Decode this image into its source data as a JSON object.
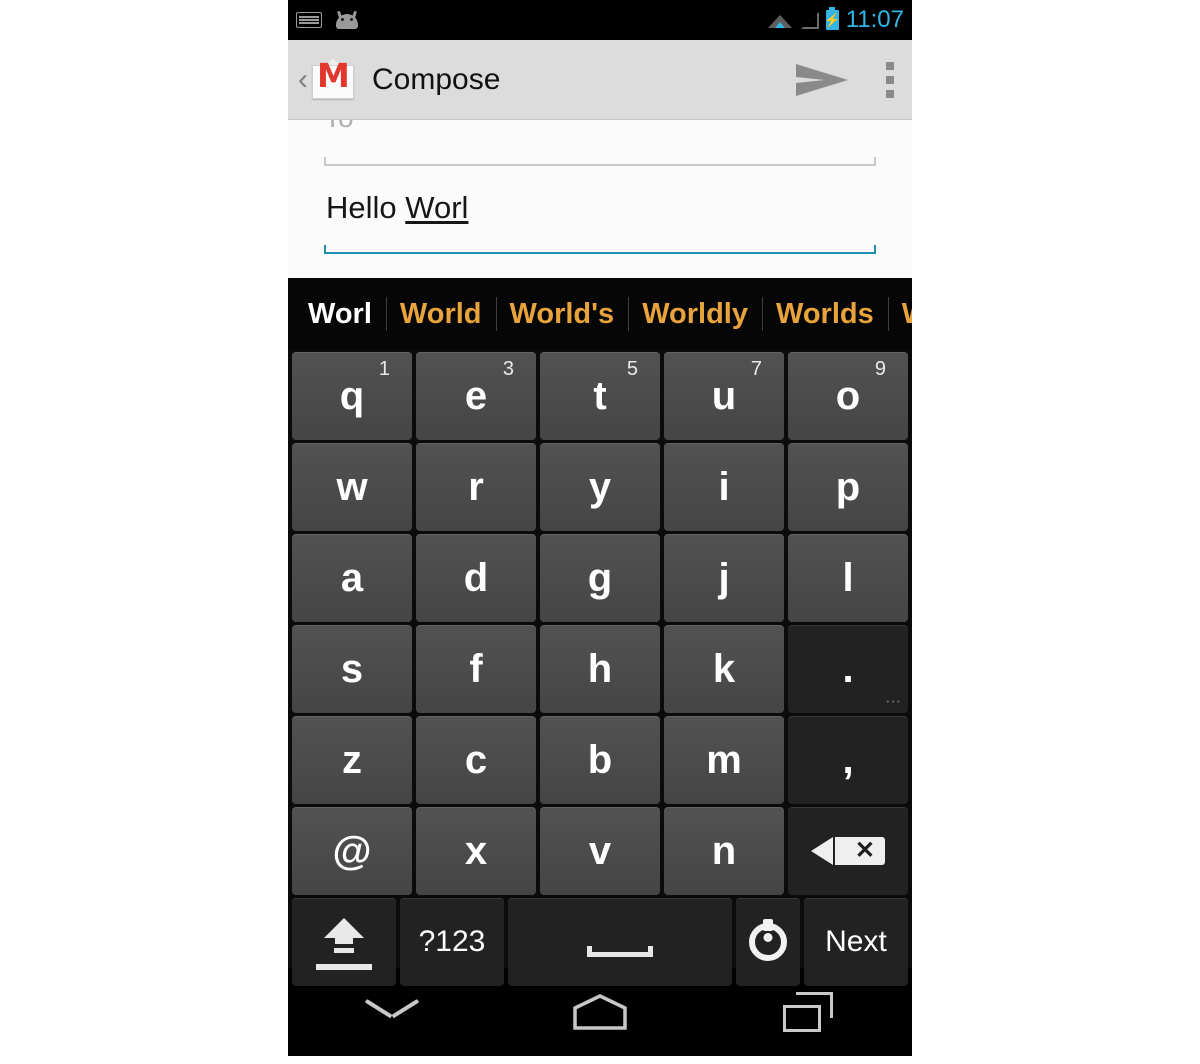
{
  "status_bar": {
    "icons": [
      "keyboard-icon",
      "android-head-icon",
      "wifi-icon",
      "signal-icon",
      "battery-charging-icon"
    ],
    "time": "11:07",
    "time_color": "#33b5e5"
  },
  "action_bar": {
    "back_glyph": "‹",
    "app_icon": "gmail-icon",
    "app_icon_letter": "M",
    "title": "Compose",
    "send_label": "send-icon",
    "overflow_label": "more-options-icon"
  },
  "compose": {
    "to_label": "To",
    "subject_committed": "Hello ",
    "subject_composing": "Worl",
    "focused_underline_color": "#1c90ae",
    "idle_underline_color": "#c9c9c9"
  },
  "suggestions": {
    "typed_color": "#ffffff",
    "suggestion_color": "#e8a33d",
    "items": [
      {
        "label": "Worl",
        "typed": true
      },
      {
        "label": "World",
        "typed": false
      },
      {
        "label": "World's",
        "typed": false
      },
      {
        "label": "Worldly",
        "typed": false
      },
      {
        "label": "Worlds",
        "typed": false
      },
      {
        "label": "Worldwide",
        "typed": false
      }
    ]
  },
  "keyboard": {
    "rows": [
      [
        {
          "label": "q",
          "alt": "1",
          "type": "char"
        },
        {
          "label": "e",
          "alt": "3",
          "type": "char"
        },
        {
          "label": "t",
          "alt": "5",
          "type": "char"
        },
        {
          "label": "u",
          "alt": "7",
          "type": "char"
        },
        {
          "label": "o",
          "alt": "9",
          "type": "char"
        }
      ],
      [
        {
          "label": "w",
          "alt": "",
          "type": "char"
        },
        {
          "label": "r",
          "alt": "",
          "type": "char"
        },
        {
          "label": "y",
          "alt": "",
          "type": "char"
        },
        {
          "label": "i",
          "alt": "",
          "type": "char"
        },
        {
          "label": "p",
          "alt": "",
          "type": "char"
        }
      ],
      [
        {
          "label": "a",
          "alt": "",
          "type": "char"
        },
        {
          "label": "d",
          "alt": "",
          "type": "char"
        },
        {
          "label": "g",
          "alt": "",
          "type": "char"
        },
        {
          "label": "j",
          "alt": "",
          "type": "char"
        },
        {
          "label": "l",
          "alt": "",
          "type": "char"
        }
      ],
      [
        {
          "label": "s",
          "alt": "",
          "type": "char"
        },
        {
          "label": "f",
          "alt": "",
          "type": "char"
        },
        {
          "label": "h",
          "alt": "",
          "type": "char"
        },
        {
          "label": "k",
          "alt": "",
          "type": "char"
        },
        {
          "label": ".",
          "alt": "",
          "type": "char",
          "dark": true,
          "dots": true
        }
      ],
      [
        {
          "label": "z",
          "alt": "",
          "type": "char"
        },
        {
          "label": "c",
          "alt": "",
          "type": "char"
        },
        {
          "label": "b",
          "alt": "",
          "type": "char"
        },
        {
          "label": "m",
          "alt": "",
          "type": "char"
        },
        {
          "label": ",",
          "alt": "",
          "type": "char",
          "dark": true
        }
      ],
      [
        {
          "label": "@",
          "alt": "",
          "type": "char"
        },
        {
          "label": "x",
          "alt": "",
          "type": "char"
        },
        {
          "label": "v",
          "alt": "",
          "type": "char"
        },
        {
          "label": "n",
          "alt": "",
          "type": "char"
        },
        {
          "label": "",
          "alt": "",
          "type": "backspace",
          "dark": true
        }
      ],
      [
        {
          "label": "",
          "alt": "",
          "type": "shift",
          "dark": true
        },
        {
          "label": "?123",
          "alt": "",
          "type": "symbols",
          "dark": true
        },
        {
          "label": "",
          "alt": "",
          "type": "space",
          "dark": true
        },
        {
          "label": "",
          "alt": "",
          "type": "settings",
          "dark": true
        },
        {
          "label": "Next",
          "alt": "",
          "type": "action",
          "dark": true
        }
      ]
    ]
  },
  "nav_bar": {
    "buttons": [
      "hide-keyboard-icon",
      "home-icon",
      "recent-apps-icon"
    ]
  }
}
